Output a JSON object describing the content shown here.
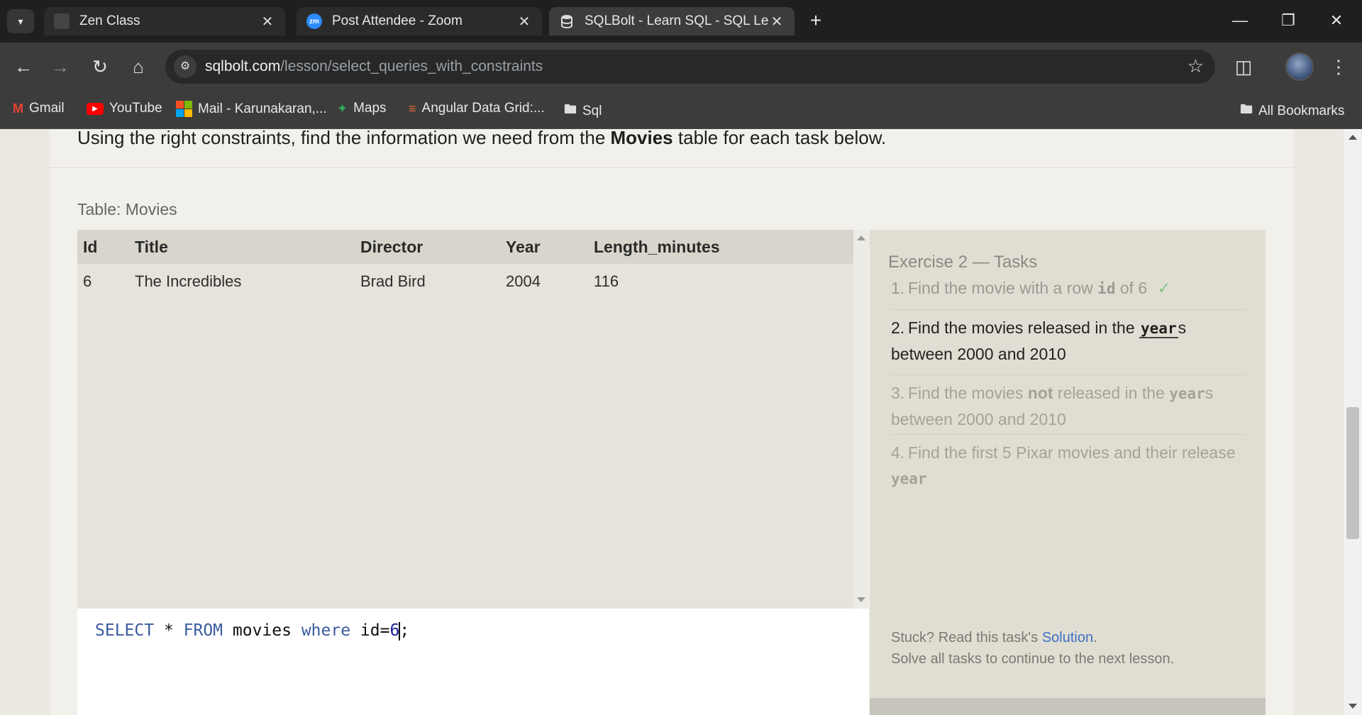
{
  "browser": {
    "tabs": [
      {
        "title": "Zen Class",
        "active": false
      },
      {
        "title": "Post Attendee - Zoom",
        "active": false,
        "favicon_text": "zm"
      },
      {
        "title": "SQLBolt - Learn SQL - SQL Lesso",
        "active": true
      }
    ],
    "url_host": "sqlbolt.com",
    "url_path": "/lesson/select_queries_with_constraints",
    "bookmarks": [
      {
        "label": "Gmail",
        "icon": "gmail-icon"
      },
      {
        "label": "YouTube",
        "icon": "youtube-icon"
      },
      {
        "label": "Mail - Karunakaran,...",
        "icon": "microsoft-icon"
      },
      {
        "label": "Maps",
        "icon": "maps-icon"
      },
      {
        "label": "Angular Data Grid:...",
        "icon": "grid-icon"
      },
      {
        "label": "Sql",
        "icon": "folder-icon"
      }
    ],
    "all_bookmarks": "All Bookmarks"
  },
  "lesson": {
    "intro_before": "Using the right constraints, find the information we need from the ",
    "intro_bold": "Movies",
    "intro_after": " table for each task below."
  },
  "table": {
    "label": "Table: Movies",
    "columns": [
      "Id",
      "Title",
      "Director",
      "Year",
      "Length_minutes"
    ],
    "rows": [
      [
        "6",
        "The Incredibles",
        "Brad Bird",
        "2004",
        "116"
      ]
    ]
  },
  "editor": {
    "kw1": "SELECT",
    "t1": " * ",
    "kw2": "FROM",
    "t2": " movies ",
    "kw3": "where",
    "t3": " id=",
    "num": "6",
    "t4": ";"
  },
  "tasks": {
    "title": "Exercise 2 — Tasks",
    "items": [
      {
        "n": "1.",
        "pre": "Find the movie with a row ",
        "code": "id",
        "post": " of 6",
        "status": "done"
      },
      {
        "n": "2.",
        "pre": "Find the movies released in the ",
        "code": "year",
        "post": "s between 2000 and 2010",
        "status": "current"
      },
      {
        "n": "3.",
        "pre": "Find the movies ",
        "bold": "not",
        "mid": " released in the ",
        "code": "year",
        "post": "s between 2000 and 2010",
        "status": "todo"
      },
      {
        "n": "4.",
        "pre": "Find the first 5 Pixar movies and their release ",
        "code": "year",
        "post": "",
        "status": "todo"
      }
    ],
    "check": "✓",
    "stuck_pre": "Stuck? Read this task's ",
    "solution_link": "Solution",
    "stuck_post": ".",
    "solve_all": "Solve all tasks to continue to the next lesson."
  }
}
